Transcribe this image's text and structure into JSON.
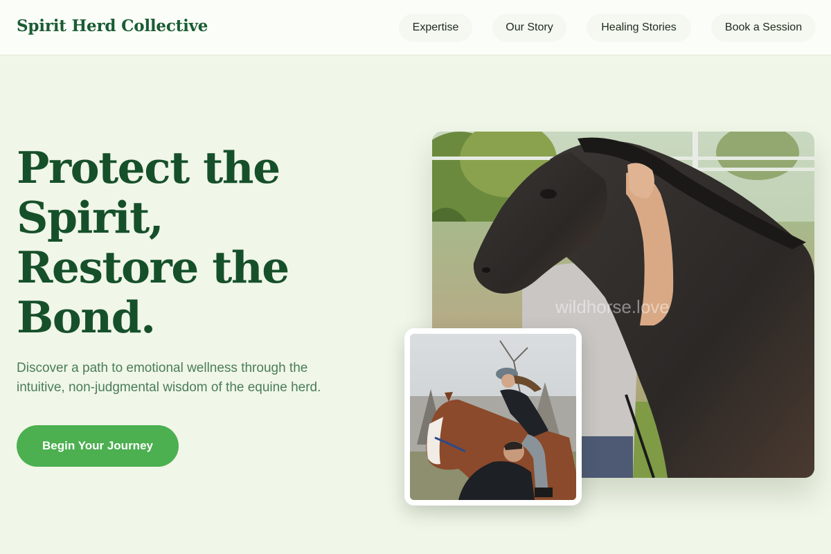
{
  "brand": {
    "name": "Spirit Herd Collective"
  },
  "nav": {
    "items": [
      {
        "label": "Expertise"
      },
      {
        "label": "Our Story"
      },
      {
        "label": "Healing Stories"
      },
      {
        "label": "Book a Session"
      }
    ]
  },
  "hero": {
    "title_lines": [
      "Protect the",
      "Spirit,",
      "Restore the",
      "Bond."
    ],
    "subtitle_lines": [
      "Discover a path to emotional wellness through the",
      "intuitive, non-judgmental wisdom of the equine herd."
    ],
    "cta_label": "Begin Your Journey"
  },
  "images": {
    "main_alt": "Man hugging a dark horse's neck in a green paddock",
    "main_watermark": "wildhorse.love",
    "inset_alt": "Rider in a cap mounting a chestnut horse while a man helps"
  },
  "colors": {
    "brand_green": "#1a5c32",
    "cta_green": "#4caf50",
    "page_background": "#f0f6e8",
    "subtitle_green": "#4a7d58"
  }
}
